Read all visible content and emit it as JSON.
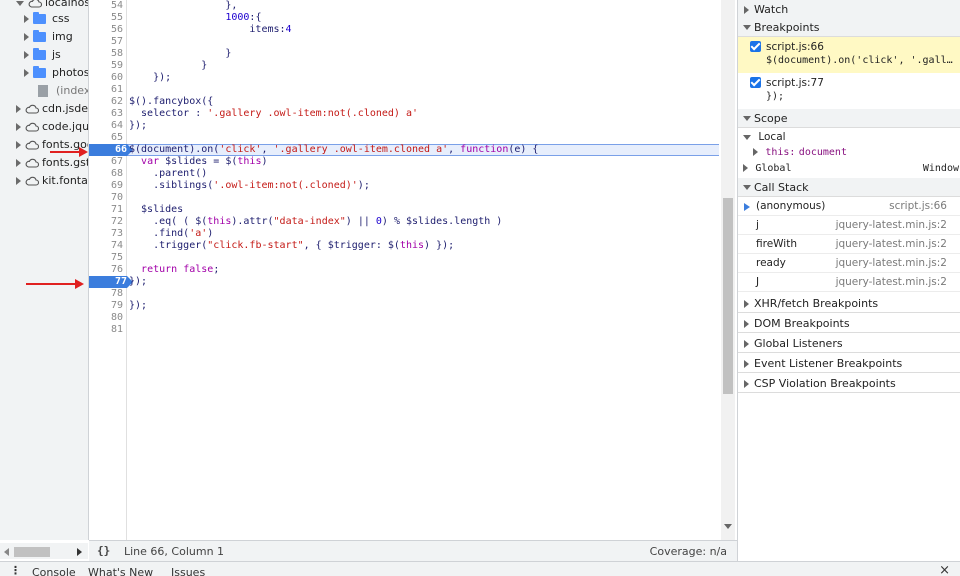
{
  "file_tree": {
    "items": [
      {
        "label": "localhost",
        "indent": 1,
        "kind": "host-open"
      },
      {
        "label": "css",
        "indent": 2,
        "kind": "folder"
      },
      {
        "label": "img",
        "indent": 2,
        "kind": "folder"
      },
      {
        "label": "js",
        "indent": 2,
        "kind": "folder"
      },
      {
        "label": "photos",
        "indent": 2,
        "kind": "folder"
      },
      {
        "label": "(index)",
        "indent": 2,
        "kind": "file"
      },
      {
        "label": "cdn.jsdelivr.net",
        "indent": 1,
        "kind": "cloud"
      },
      {
        "label": "code.jquery.com",
        "indent": 1,
        "kind": "cloud"
      },
      {
        "label": "fonts.googleapis.com",
        "indent": 1,
        "kind": "cloud"
      },
      {
        "label": "fonts.gstatic.com",
        "indent": 1,
        "kind": "cloud"
      },
      {
        "label": "kit.fontawesome.com",
        "indent": 1,
        "kind": "cloud"
      }
    ]
  },
  "editor": {
    "lines": [
      {
        "n": "54",
        "code": "                },"
      },
      {
        "n": "55",
        "code": "                1000:{"
      },
      {
        "n": "56",
        "code": "                    items:4"
      },
      {
        "n": "57",
        "code": ""
      },
      {
        "n": "58",
        "code": "                }"
      },
      {
        "n": "59",
        "code": "            }"
      },
      {
        "n": "60",
        "code": "    });"
      },
      {
        "n": "61",
        "code": ""
      },
      {
        "n": "62",
        "code": "$().fancybox({"
      },
      {
        "n": "63",
        "code": "  selector : '.gallery .owl-item:not(.cloned) a'"
      },
      {
        "n": "64",
        "code": "});"
      },
      {
        "n": "65",
        "code": ""
      },
      {
        "n": "66",
        "code": "$(document).on('click', '.gallery .owl-item.cloned a', function(e) {",
        "breakpoint": true,
        "current": true
      },
      {
        "n": "67",
        "code": "  var $slides = $(this)"
      },
      {
        "n": "68",
        "code": "    .parent()"
      },
      {
        "n": "69",
        "code": "    .siblings('.owl-item:not(.cloned)');"
      },
      {
        "n": "70",
        "code": ""
      },
      {
        "n": "71",
        "code": "  $slides"
      },
      {
        "n": "72",
        "code": "    .eq( ( $(this).attr(\"data-index\") || 0) % $slides.length )"
      },
      {
        "n": "73",
        "code": "    .find('a')"
      },
      {
        "n": "74",
        "code": "    .trigger(\"click.fb-start\", { $trigger: $(this) });"
      },
      {
        "n": "75",
        "code": ""
      },
      {
        "n": "76",
        "code": "  return false;"
      },
      {
        "n": "77",
        "code": "});",
        "breakpoint": true
      },
      {
        "n": "78",
        "code": ""
      },
      {
        "n": "79",
        "code": "});"
      },
      {
        "n": "80",
        "code": ""
      },
      {
        "n": "81",
        "code": ""
      }
    ]
  },
  "status_bar": {
    "format_icon": "{}",
    "position": "Line 66, Column 1",
    "coverage": "Coverage: n/a"
  },
  "drawer": {
    "tabs": [
      "Console",
      "What's New",
      "Issues"
    ],
    "close": "×"
  },
  "sidebar": {
    "watch": "Watch",
    "breakpoints": "Breakpoints",
    "breakpoint_items": [
      {
        "file": "script.js:66",
        "code": "$(document).on('click', '.gall…",
        "active": true
      },
      {
        "file": "script.js:77",
        "code": "});",
        "active": false
      }
    ],
    "scope": "Scope",
    "scope_local": "Local",
    "scope_this_key": "this:",
    "scope_this_val": "document",
    "scope_global": "Global",
    "scope_global_val": "Window",
    "call_stack": "Call Stack",
    "call_stack_items": [
      {
        "fn": "(anonymous)",
        "loc": "script.js:66",
        "current": true
      },
      {
        "fn": "j",
        "loc": "jquery-latest.min.js:2"
      },
      {
        "fn": "fireWith",
        "loc": "jquery-latest.min.js:2"
      },
      {
        "fn": "ready",
        "loc": "jquery-latest.min.js:2"
      },
      {
        "fn": "J",
        "loc": "jquery-latest.min.js:2"
      }
    ],
    "collapsed_sections": [
      "XHR/fetch Breakpoints",
      "DOM Breakpoints",
      "Global Listeners",
      "Event Listener Breakpoints",
      "CSP Violation Breakpoints"
    ]
  },
  "colors": {
    "breakpoint_blue": "#3b7ddd",
    "annotation_red": "#e02020",
    "active_breakpoint_bg": "#fff9c4"
  }
}
